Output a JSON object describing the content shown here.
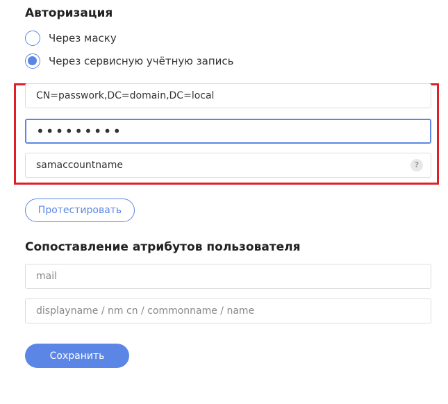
{
  "auth": {
    "title": "Авторизация",
    "options": [
      {
        "label": "Через маску",
        "checked": false
      },
      {
        "label": "Через сервисную учётную запись",
        "checked": true
      }
    ],
    "fields": {
      "dn_value": "CN=passwork,DC=domain,DC=local",
      "password_value": "•••••••••",
      "attribute_value": "samaccountname"
    },
    "help_icon_glyph": "?",
    "test_button_label": "Протестировать"
  },
  "mapping": {
    "title": "Сопоставление атрибутов пользователя",
    "email_placeholder": "mail",
    "name_placeholder": "displayname / nm cn / commonname / name"
  },
  "save_button_label": "Сохранить",
  "colors": {
    "accent": "#5b86e5",
    "highlight_border": "#e01e26"
  }
}
